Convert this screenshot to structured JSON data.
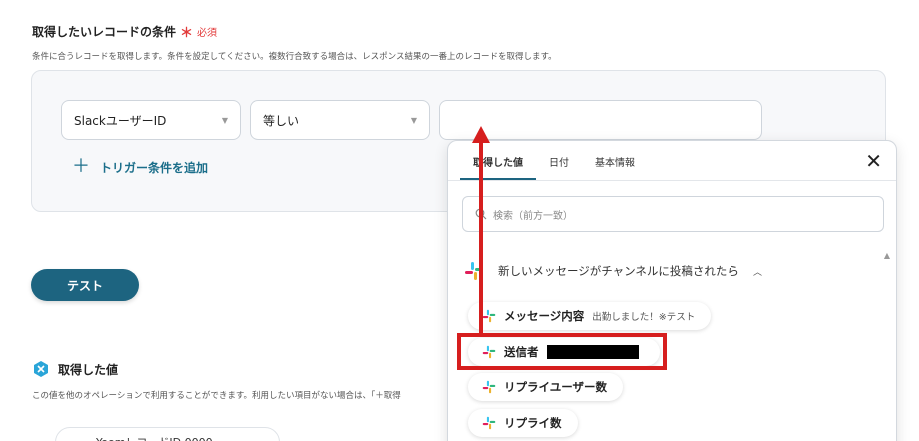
{
  "condition": {
    "title": "取得したいレコードの条件",
    "required_mark": "＊",
    "required_text": "必須",
    "description": "条件に合うレコードを取得します。条件を設定してください。複数行合致する場合は、レスポンス結果の一番上のレコードを取得します。",
    "field_value": "SlackユーザーID",
    "operator_value": "等しい",
    "value_placeholder": "",
    "add_trigger_label": "トリガー条件を追加"
  },
  "test_button_label": "テスト",
  "obtained": {
    "title": "取得した値",
    "description": "この値を他のオペレーションで利用することができます。利用したい項目がない場合は、「＋取得",
    "partial_chip": "YoomレコードID 0000"
  },
  "panel": {
    "tabs": [
      "取得した値",
      "日付",
      "基本情報"
    ],
    "active_tab": 0,
    "close_icon": "close-icon",
    "search_placeholder": "検索（前方一致）",
    "group_title": "新しいメッセージがチャンネルに投稿されたら",
    "items": [
      {
        "label": "メッセージ内容",
        "sub": "出勤しました！※テスト"
      },
      {
        "label": "送信者",
        "sub": ""
      },
      {
        "label": "リプライユーザー数",
        "sub": ""
      },
      {
        "label": "リプライ数",
        "sub": ""
      }
    ]
  },
  "colors": {
    "accent": "#1d6480",
    "required": "#e23a3a",
    "annotation": "#d61e1e"
  }
}
